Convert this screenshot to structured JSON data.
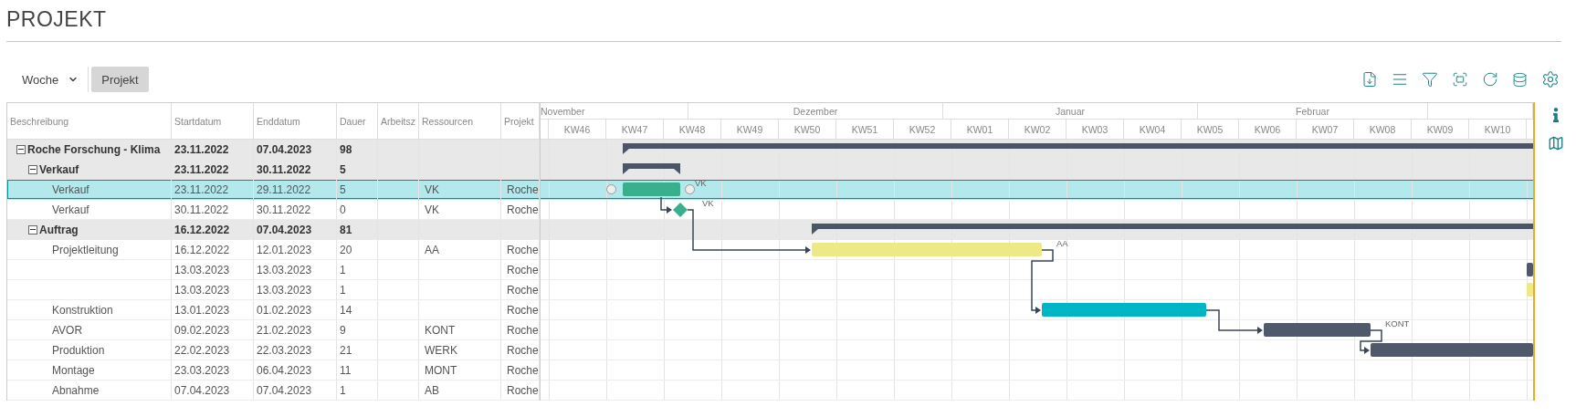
{
  "page_title": "PROJEKT",
  "toolbar": {
    "scale": {
      "value": "Woche"
    },
    "view_button": {
      "label": "Projekt",
      "selected": true
    }
  },
  "table": {
    "columns": [
      "Beschreibung",
      "Startdatum",
      "Enddatum",
      "Dauer",
      "Arbeitsz",
      "Ressourcen",
      "Projekt"
    ],
    "rows": [
      {
        "kind": "summary",
        "name": "Roche Forschung - Klima",
        "start": "23.11.2022",
        "end": "07.04.2023",
        "duration": "98",
        "expanded": true,
        "selected": false,
        "children": [
          {
            "kind": "summary",
            "name": "Verkauf",
            "start": "23.11.2022",
            "end": "30.11.2022",
            "duration": "5",
            "expanded": true,
            "selected": false,
            "children": [
              {
                "kind": "task",
                "name": "Verkauf",
                "start": "23.11.2022",
                "end": "29.11.2022",
                "duration": "5",
                "resource": "VK",
                "project": "Roche",
                "bar_label": "VK",
                "color": "#3aaf8e",
                "selected": true
              },
              {
                "kind": "milestone",
                "name": "Verkauf",
                "start": "30.11.2022",
                "end": "30.11.2022",
                "duration": "0",
                "resource": "VK",
                "project": "Roche",
                "bar_label": "VK",
                "color": "#3aaf8e",
                "selected": false
              }
            ]
          },
          {
            "kind": "summary",
            "name": "Auftrag",
            "start": "16.12.2022",
            "end": "07.04.2023",
            "duration": "81",
            "expanded": true,
            "selected": false,
            "children": [
              {
                "kind": "task",
                "name": "Projektleitung",
                "start": "16.12.2022",
                "end": "12.01.2023",
                "duration": "20",
                "resource": "AA",
                "project": "Roche",
                "bar_label": "AA",
                "color": "#ede986",
                "selected": false
              },
              {
                "kind": "task",
                "start": "13.03.2023",
                "end": "13.03.2023",
                "duration": "1",
                "project": "Roche",
                "color": "#4f596b",
                "selected": false
              },
              {
                "kind": "task",
                "start": "13.03.2023",
                "end": "13.03.2023",
                "duration": "1",
                "project": "Roche",
                "color": "#ede986",
                "selected": false
              },
              {
                "kind": "task",
                "name": "Konstruktion",
                "start": "13.01.2023",
                "end": "01.02.2023",
                "duration": "14",
                "project": "Roche",
                "color": "#00b5c4",
                "selected": false
              },
              {
                "kind": "task",
                "name": "AVOR",
                "start": "09.02.2023",
                "end": "21.02.2023",
                "duration": "9",
                "resource": "KONT",
                "project": "Roche",
                "bar_label": "KONT",
                "color": "#4f596b",
                "selected": false
              },
              {
                "kind": "task",
                "name": "Produktion",
                "start": "22.02.2023",
                "end": "22.03.2023",
                "duration": "21",
                "resource": "WERK",
                "project": "Roche",
                "color": "#4f596b",
                "selected": false
              },
              {
                "kind": "task",
                "name": "Montage",
                "start": "23.03.2023",
                "end": "06.04.2023",
                "duration": "11",
                "resource": "MONT",
                "project": "Roche",
                "selected": false
              },
              {
                "kind": "task",
                "name": "Abnahme",
                "start": "07.04.2023",
                "end": "07.04.2023",
                "duration": "1",
                "resource": "AB",
                "project": "Roche",
                "selected": false
              }
            ]
          }
        ]
      }
    ]
  },
  "gantt": {
    "months": [
      "November",
      "Dezember",
      "Januar",
      "Februar"
    ],
    "weeks": [
      "KW46",
      "KW47",
      "KW48",
      "KW49",
      "KW50",
      "KW51",
      "KW52",
      "KW01",
      "KW02",
      "KW03",
      "KW04",
      "KW05",
      "KW06",
      "KW07",
      "KW08",
      "KW09",
      "KW10"
    ]
  }
}
